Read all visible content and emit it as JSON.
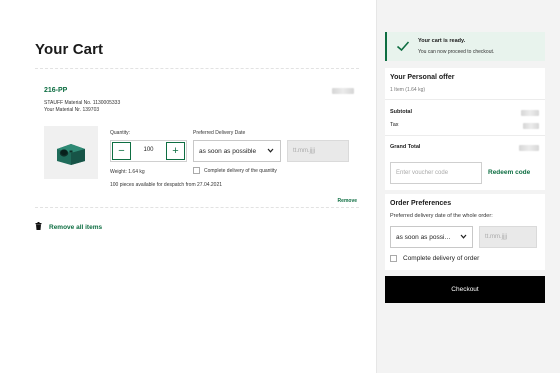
{
  "cart": {
    "title": "Your Cart",
    "item": {
      "sku": "216-PP",
      "material_no": "STAUFF Material No. 1130005333",
      "your_material": "Your Material Nr. 139703",
      "quantity_label": "Quantity:",
      "minus_label": "−",
      "plus_label": "+",
      "quantity_value": "100",
      "weight": "Weight: 1.64 kg",
      "delivery_label": "Preferred Delivery Date",
      "delivery_select": "as soon as possible",
      "date_placeholder": "tt.mm.jjjj",
      "complete_delivery": "Complete delivery of the quantity",
      "stock_info": "100 pieces available for despatch from 27.04.2021",
      "remove": "Remove"
    },
    "remove_all": "Remove all items"
  },
  "toast": {
    "title": "Your cart is ready.",
    "subtitle": "You can now proceed to checkout."
  },
  "offer": {
    "title": "Your Personal offer",
    "items_summary": "1 Item (1.64 kg)",
    "subtotal_label": "Subtotal",
    "tax_label": "Tax",
    "total_label": "Grand Total",
    "voucher_placeholder": "Enter voucher code",
    "redeem": "Redeem code"
  },
  "order_preferences": {
    "title": "Order Preferences",
    "subtitle": "Preferred delivery date of the whole order:",
    "select_value": "as soon as possi…",
    "date_placeholder": "tt.mm.jjjj",
    "complete_delivery": "Complete delivery of order"
  },
  "checkout_label": "Checkout",
  "colors": {
    "accent": "#0e6e42",
    "checkout_bg": "#000000",
    "toast_bg": "#e8f3ed"
  }
}
